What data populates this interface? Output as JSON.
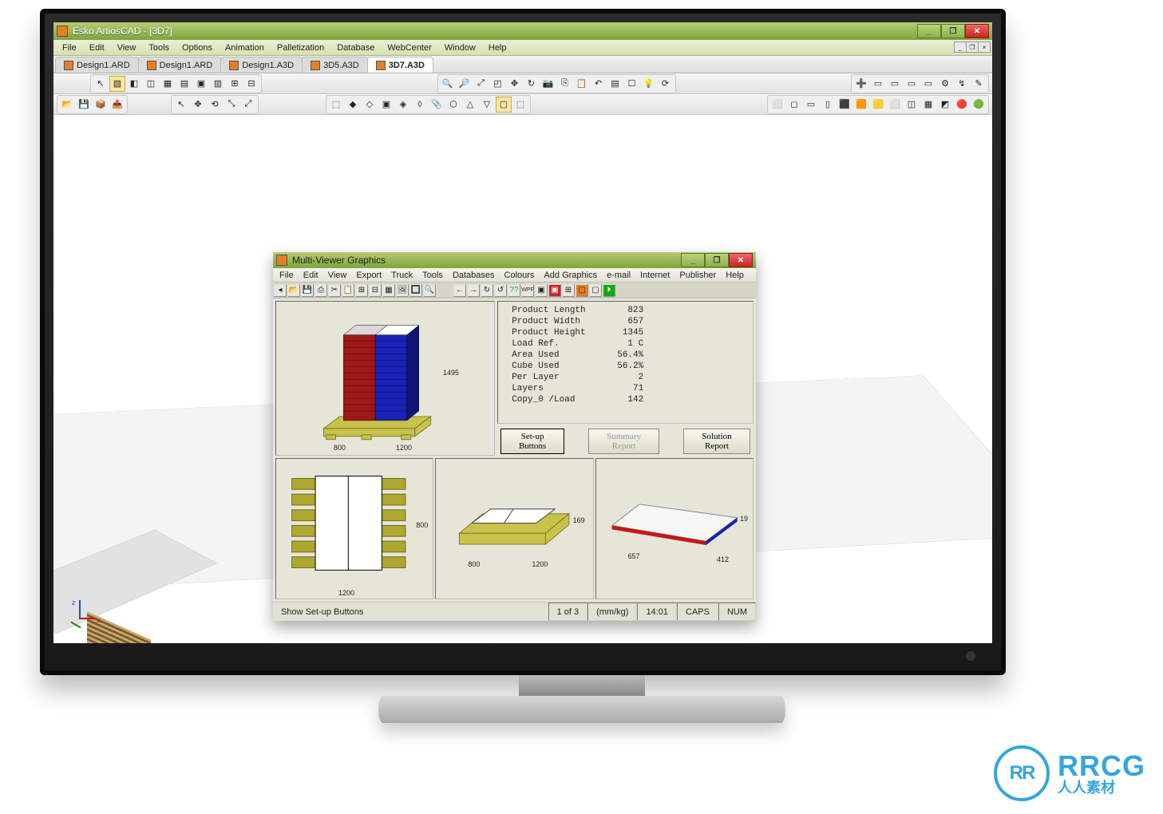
{
  "app": {
    "title": "Esko ArtiosCAD - [3D7]",
    "menu": [
      "File",
      "Edit",
      "View",
      "Tools",
      "Options",
      "Animation",
      "Palletization",
      "Database",
      "WebCenter",
      "Window",
      "Help"
    ],
    "tabs": [
      {
        "label": "Design1.ARD",
        "active": false
      },
      {
        "label": "Design1.ARD",
        "active": false
      },
      {
        "label": "Design1.A3D",
        "active": false
      },
      {
        "label": "3D5.A3D",
        "active": false
      },
      {
        "label": "3D7.A3D",
        "active": true
      }
    ],
    "axis": {
      "x": "x",
      "z": "z"
    }
  },
  "inner": {
    "title": "Multi-Viewer Graphics",
    "menu": [
      "File",
      "Edit",
      "View",
      "Export",
      "Truck",
      "Tools",
      "Databases",
      "Colours",
      "Add Graphics",
      "e-mail",
      "Internet",
      "Publisher",
      "Help"
    ],
    "buttons": {
      "setup": "Set-up Buttons",
      "summary": "Summary Report",
      "solution": "Solution Report"
    },
    "stats": [
      {
        "k": "Product Length",
        "v": "823"
      },
      {
        "k": "Product Width",
        "v": "657"
      },
      {
        "k": "Product Height",
        "v": "1345"
      },
      {
        "k": "Load Ref.",
        "v": "1 C"
      },
      {
        "k": "Area Used",
        "v": "56.4%"
      },
      {
        "k": "Cube Used",
        "v": "56.2%"
      },
      {
        "k": "Per Layer",
        "v": "2"
      },
      {
        "k": "Layers",
        "v": "71"
      },
      {
        "k": "Copy_0 /Load",
        "v": "142"
      }
    ],
    "dims3d": {
      "h": "1495",
      "w": "800",
      "d": "1200"
    },
    "topview": {
      "w": "1200",
      "h": "800"
    },
    "layer": {
      "w": "800",
      "d": "1200",
      "h": "169"
    },
    "item": {
      "a": "657",
      "b": "412",
      "c": "19"
    },
    "status": {
      "msg": "Show Set-up Buttons",
      "page": "1 of 3",
      "units": "(mm/kg)",
      "time": "14:01",
      "caps": "CAPS",
      "num": "NUM"
    }
  },
  "watermark": {
    "icon": "RR",
    "line1": "RRCG",
    "line2": "人人素材"
  }
}
